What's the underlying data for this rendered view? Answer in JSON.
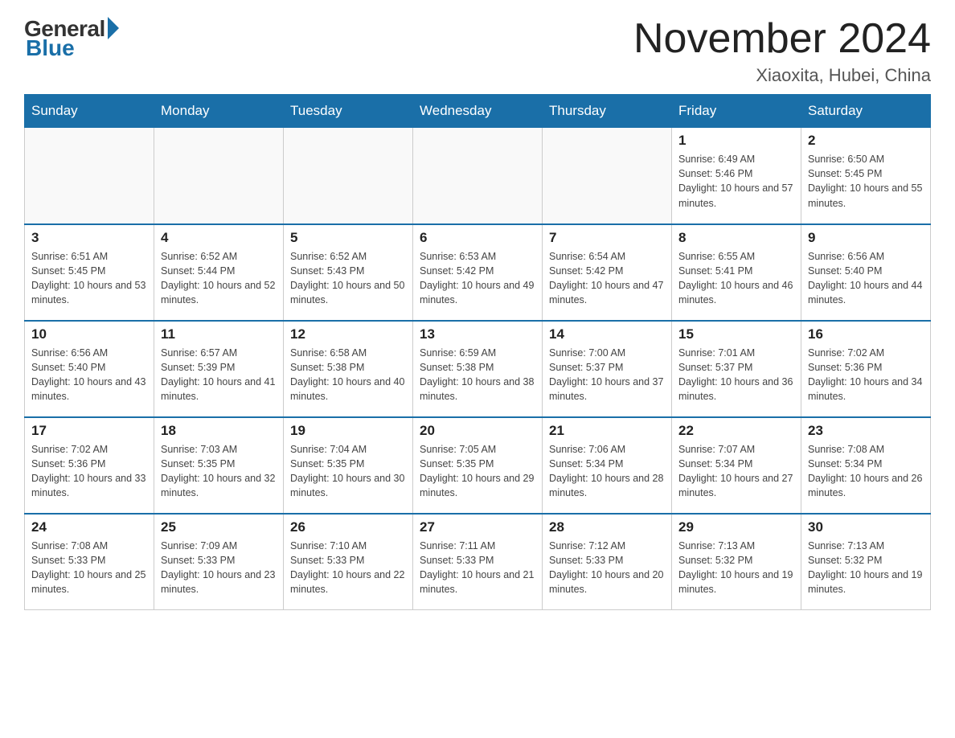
{
  "header": {
    "logo_general": "General",
    "logo_blue": "Blue",
    "month_title": "November 2024",
    "location": "Xiaoxita, Hubei, China"
  },
  "days_of_week": [
    "Sunday",
    "Monday",
    "Tuesday",
    "Wednesday",
    "Thursday",
    "Friday",
    "Saturday"
  ],
  "weeks": [
    [
      {
        "day": "",
        "sunrise": "",
        "sunset": "",
        "daylight": "",
        "empty": true
      },
      {
        "day": "",
        "sunrise": "",
        "sunset": "",
        "daylight": "",
        "empty": true
      },
      {
        "day": "",
        "sunrise": "",
        "sunset": "",
        "daylight": "",
        "empty": true
      },
      {
        "day": "",
        "sunrise": "",
        "sunset": "",
        "daylight": "",
        "empty": true
      },
      {
        "day": "",
        "sunrise": "",
        "sunset": "",
        "daylight": "",
        "empty": true
      },
      {
        "day": "1",
        "sunrise": "Sunrise: 6:49 AM",
        "sunset": "Sunset: 5:46 PM",
        "daylight": "Daylight: 10 hours and 57 minutes.",
        "empty": false
      },
      {
        "day": "2",
        "sunrise": "Sunrise: 6:50 AM",
        "sunset": "Sunset: 5:45 PM",
        "daylight": "Daylight: 10 hours and 55 minutes.",
        "empty": false
      }
    ],
    [
      {
        "day": "3",
        "sunrise": "Sunrise: 6:51 AM",
        "sunset": "Sunset: 5:45 PM",
        "daylight": "Daylight: 10 hours and 53 minutes.",
        "empty": false
      },
      {
        "day": "4",
        "sunrise": "Sunrise: 6:52 AM",
        "sunset": "Sunset: 5:44 PM",
        "daylight": "Daylight: 10 hours and 52 minutes.",
        "empty": false
      },
      {
        "day": "5",
        "sunrise": "Sunrise: 6:52 AM",
        "sunset": "Sunset: 5:43 PM",
        "daylight": "Daylight: 10 hours and 50 minutes.",
        "empty": false
      },
      {
        "day": "6",
        "sunrise": "Sunrise: 6:53 AM",
        "sunset": "Sunset: 5:42 PM",
        "daylight": "Daylight: 10 hours and 49 minutes.",
        "empty": false
      },
      {
        "day": "7",
        "sunrise": "Sunrise: 6:54 AM",
        "sunset": "Sunset: 5:42 PM",
        "daylight": "Daylight: 10 hours and 47 minutes.",
        "empty": false
      },
      {
        "day": "8",
        "sunrise": "Sunrise: 6:55 AM",
        "sunset": "Sunset: 5:41 PM",
        "daylight": "Daylight: 10 hours and 46 minutes.",
        "empty": false
      },
      {
        "day": "9",
        "sunrise": "Sunrise: 6:56 AM",
        "sunset": "Sunset: 5:40 PM",
        "daylight": "Daylight: 10 hours and 44 minutes.",
        "empty": false
      }
    ],
    [
      {
        "day": "10",
        "sunrise": "Sunrise: 6:56 AM",
        "sunset": "Sunset: 5:40 PM",
        "daylight": "Daylight: 10 hours and 43 minutes.",
        "empty": false
      },
      {
        "day": "11",
        "sunrise": "Sunrise: 6:57 AM",
        "sunset": "Sunset: 5:39 PM",
        "daylight": "Daylight: 10 hours and 41 minutes.",
        "empty": false
      },
      {
        "day": "12",
        "sunrise": "Sunrise: 6:58 AM",
        "sunset": "Sunset: 5:38 PM",
        "daylight": "Daylight: 10 hours and 40 minutes.",
        "empty": false
      },
      {
        "day": "13",
        "sunrise": "Sunrise: 6:59 AM",
        "sunset": "Sunset: 5:38 PM",
        "daylight": "Daylight: 10 hours and 38 minutes.",
        "empty": false
      },
      {
        "day": "14",
        "sunrise": "Sunrise: 7:00 AM",
        "sunset": "Sunset: 5:37 PM",
        "daylight": "Daylight: 10 hours and 37 minutes.",
        "empty": false
      },
      {
        "day": "15",
        "sunrise": "Sunrise: 7:01 AM",
        "sunset": "Sunset: 5:37 PM",
        "daylight": "Daylight: 10 hours and 36 minutes.",
        "empty": false
      },
      {
        "day": "16",
        "sunrise": "Sunrise: 7:02 AM",
        "sunset": "Sunset: 5:36 PM",
        "daylight": "Daylight: 10 hours and 34 minutes.",
        "empty": false
      }
    ],
    [
      {
        "day": "17",
        "sunrise": "Sunrise: 7:02 AM",
        "sunset": "Sunset: 5:36 PM",
        "daylight": "Daylight: 10 hours and 33 minutes.",
        "empty": false
      },
      {
        "day": "18",
        "sunrise": "Sunrise: 7:03 AM",
        "sunset": "Sunset: 5:35 PM",
        "daylight": "Daylight: 10 hours and 32 minutes.",
        "empty": false
      },
      {
        "day": "19",
        "sunrise": "Sunrise: 7:04 AM",
        "sunset": "Sunset: 5:35 PM",
        "daylight": "Daylight: 10 hours and 30 minutes.",
        "empty": false
      },
      {
        "day": "20",
        "sunrise": "Sunrise: 7:05 AM",
        "sunset": "Sunset: 5:35 PM",
        "daylight": "Daylight: 10 hours and 29 minutes.",
        "empty": false
      },
      {
        "day": "21",
        "sunrise": "Sunrise: 7:06 AM",
        "sunset": "Sunset: 5:34 PM",
        "daylight": "Daylight: 10 hours and 28 minutes.",
        "empty": false
      },
      {
        "day": "22",
        "sunrise": "Sunrise: 7:07 AM",
        "sunset": "Sunset: 5:34 PM",
        "daylight": "Daylight: 10 hours and 27 minutes.",
        "empty": false
      },
      {
        "day": "23",
        "sunrise": "Sunrise: 7:08 AM",
        "sunset": "Sunset: 5:34 PM",
        "daylight": "Daylight: 10 hours and 26 minutes.",
        "empty": false
      }
    ],
    [
      {
        "day": "24",
        "sunrise": "Sunrise: 7:08 AM",
        "sunset": "Sunset: 5:33 PM",
        "daylight": "Daylight: 10 hours and 25 minutes.",
        "empty": false
      },
      {
        "day": "25",
        "sunrise": "Sunrise: 7:09 AM",
        "sunset": "Sunset: 5:33 PM",
        "daylight": "Daylight: 10 hours and 23 minutes.",
        "empty": false
      },
      {
        "day": "26",
        "sunrise": "Sunrise: 7:10 AM",
        "sunset": "Sunset: 5:33 PM",
        "daylight": "Daylight: 10 hours and 22 minutes.",
        "empty": false
      },
      {
        "day": "27",
        "sunrise": "Sunrise: 7:11 AM",
        "sunset": "Sunset: 5:33 PM",
        "daylight": "Daylight: 10 hours and 21 minutes.",
        "empty": false
      },
      {
        "day": "28",
        "sunrise": "Sunrise: 7:12 AM",
        "sunset": "Sunset: 5:33 PM",
        "daylight": "Daylight: 10 hours and 20 minutes.",
        "empty": false
      },
      {
        "day": "29",
        "sunrise": "Sunrise: 7:13 AM",
        "sunset": "Sunset: 5:32 PM",
        "daylight": "Daylight: 10 hours and 19 minutes.",
        "empty": false
      },
      {
        "day": "30",
        "sunrise": "Sunrise: 7:13 AM",
        "sunset": "Sunset: 5:32 PM",
        "daylight": "Daylight: 10 hours and 19 minutes.",
        "empty": false
      }
    ]
  ]
}
